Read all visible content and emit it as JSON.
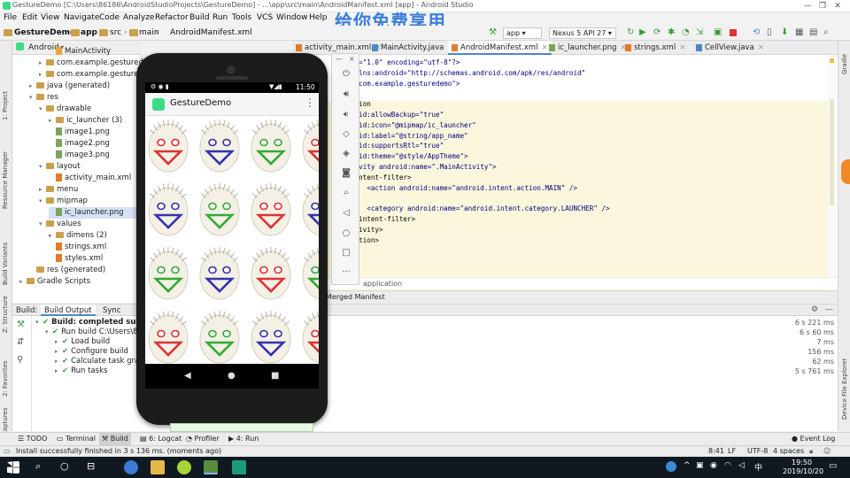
{
  "window": {
    "title": "GestureDemo [C:\\Users\\86186\\AndroidStudioProjects\\GestureDemo] - ...\\app\\src\\main\\AndroidManifest.xml [app] - Android Studio",
    "controls": [
      "—",
      "❐",
      "✕"
    ]
  },
  "watermark": "给你免费享用",
  "menu": [
    "File",
    "Edit",
    "View",
    "Navigate",
    "Code",
    "Analyze",
    "Refactor",
    "Build",
    "Run",
    "Tools",
    "VCS",
    "Window",
    "Help"
  ],
  "nav": {
    "crumbs": [
      "GestureDemo",
      "app",
      "src",
      "main",
      "AndroidManifest.xml"
    ],
    "run_config": "app",
    "device": "Nexus 5 API 27"
  },
  "left_strip": [
    "1: Project",
    "Resource Manager",
    "Build Variants",
    "Z: Structure",
    "2: Favorites",
    "Layout Captures"
  ],
  "right_strip": [
    "Gradle",
    "Device File Explorer"
  ],
  "project": {
    "view": "Android",
    "tree": [
      {
        "label": "MainActivity",
        "indent": 3,
        "icon": "file"
      },
      {
        "label": "com.example.gesturedemo",
        "indent": 2,
        "icon": "fold",
        "arrow": "▸"
      },
      {
        "label": "com.example.gesturedemo",
        "indent": 2,
        "icon": "fold",
        "arrow": "▸"
      },
      {
        "label": "java (generated)",
        "indent": 1,
        "icon": "fold",
        "arrow": "▸"
      },
      {
        "label": "res",
        "indent": 1,
        "icon": "fold",
        "arrow": "▾"
      },
      {
        "label": "drawable",
        "indent": 2,
        "icon": "fold",
        "arrow": "▾"
      },
      {
        "label": "ic_launcher (3)",
        "indent": 3,
        "icon": "fold",
        "arrow": "▸"
      },
      {
        "label": "image1.png",
        "indent": 3,
        "icon": "img"
      },
      {
        "label": "image2.png",
        "indent": 3,
        "icon": "img"
      },
      {
        "label": "image3.png",
        "indent": 3,
        "icon": "img"
      },
      {
        "label": "layout",
        "indent": 2,
        "icon": "fold",
        "arrow": "▾"
      },
      {
        "label": "activity_main.xml",
        "indent": 3,
        "icon": "xml"
      },
      {
        "label": "menu",
        "indent": 2,
        "icon": "fold",
        "arrow": "▸"
      },
      {
        "label": "mipmap",
        "indent": 2,
        "icon": "fold",
        "arrow": "▾"
      },
      {
        "label": "ic_launcher.png",
        "indent": 3,
        "icon": "img",
        "selected": true
      },
      {
        "label": "values",
        "indent": 2,
        "icon": "fold",
        "arrow": "▾"
      },
      {
        "label": "dimens (2)",
        "indent": 3,
        "icon": "fold",
        "arrow": "▸"
      },
      {
        "label": "strings.xml",
        "indent": 3,
        "icon": "xml"
      },
      {
        "label": "styles.xml",
        "indent": 3,
        "icon": "xml"
      },
      {
        "label": "res (generated)",
        "indent": 1,
        "icon": "fold"
      },
      {
        "label": "Gradle Scripts",
        "indent": 0,
        "icon": "fold",
        "arrow": "▸"
      }
    ]
  },
  "tabs": [
    {
      "label": "activity_main.xml",
      "active": false
    },
    {
      "label": "MainActivity.java",
      "active": false
    },
    {
      "label": "AndroidManifest.xml",
      "active": true
    },
    {
      "label": "ic_launcher.png",
      "active": false
    },
    {
      "label": "strings.xml",
      "active": false
    },
    {
      "label": "CellView.java",
      "active": false
    }
  ],
  "code_lines": [
    "on=\"1.0\" encoding=\"utf-8\"?>",
    "xmlns:android=\"http://schemas.android.com/apk/res/android\"",
    "=\"com.example.gesturedemo\">",
    "",
    "ation",
    "roid:allowBackup=\"true\"",
    "roid:icon=\"@mipmap/ic_launcher\"",
    "roid:label=\"@string/app_name\"",
    "roid:supportsRtl=\"true\"",
    "roid:theme=\"@style/AppTheme\">",
    "tivity android:name=\".MainActivity\">",
    "<intent-filter>",
    "    <action android:name=\"android.intent.action.MAIN\" />",
    "",
    "    <category android:name=\"android.intent.category.LAUNCHER\" />",
    "</intent-filter>",
    "ctivity>",
    "cation>"
  ],
  "editor_footer": "application",
  "merged_tab": "Merged Manifest",
  "build": {
    "header_label": "Build:",
    "tabs": [
      "Build Output",
      "Sync"
    ],
    "rows": [
      {
        "label": "Build: completed successfu",
        "time": "6 s 221 ms",
        "indent": 0,
        "bold": true
      },
      {
        "label": "Run build C:\\Users\\86186",
        "time": "6 s 60 ms",
        "indent": 1
      },
      {
        "label": "Load build",
        "time": "7 ms",
        "indent": 2
      },
      {
        "label": "Configure build",
        "time": "156 ms",
        "indent": 2
      },
      {
        "label": "Calculate task graph",
        "time": "62 ms",
        "indent": 2
      },
      {
        "label": "Run tasks",
        "time": "5 s 761 ms",
        "indent": 2
      }
    ]
  },
  "tool_windows": [
    "TODO",
    "Terminal",
    "Build",
    "6: Logcat",
    "Profiler",
    "4: Run"
  ],
  "event_log": "Event Log",
  "status": {
    "message": "Install successfully finished in 3 s 136 ms. (moments ago)",
    "position": "8:41",
    "line_sep": "LF",
    "encoding": "UTF-8",
    "indent": "4 spaces"
  },
  "emulator": {
    "time": "11:50",
    "app_title": "GestureDemo",
    "menu_dots": "⋮",
    "nav": [
      "◀",
      "●",
      "■"
    ],
    "toolbar": [
      "power-icon",
      "volume-up-icon",
      "volume-down-icon",
      "rotate-left-icon",
      "rotate-right-icon",
      "camera-icon",
      "zoom-icon",
      "back-icon",
      "home-icon",
      "overview-icon",
      "more-icon"
    ],
    "more": "···",
    "faces": [
      [
        "#d33",
        "#33a",
        "#3a3",
        "#d33"
      ],
      [
        "#33a",
        "#3a3",
        "#d33",
        "#33a"
      ],
      [
        "#3a3",
        "#33a",
        "#d33",
        "#3a3"
      ],
      [
        "#d33",
        "#3a3",
        "#33a",
        "#d33"
      ]
    ]
  },
  "taskbar": {
    "time": "19:50",
    "date": "2019/10/20",
    "ime": "中"
  }
}
